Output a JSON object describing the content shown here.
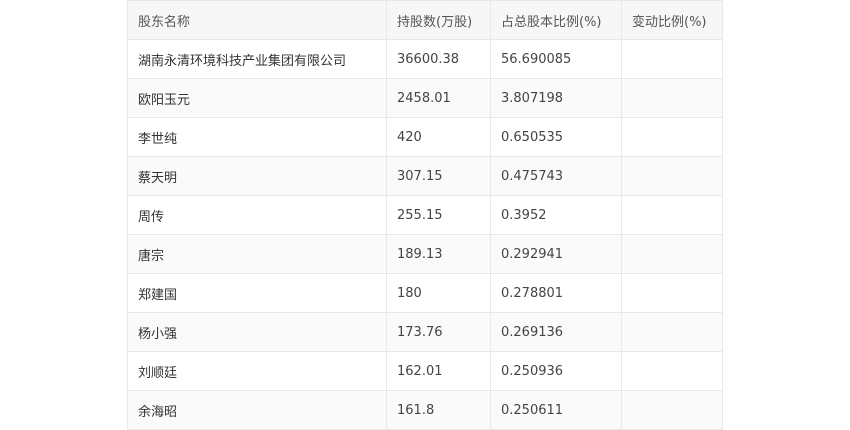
{
  "table": {
    "headers": [
      "股东名称",
      "持股数(万股)",
      "占总股本比例(%)",
      "变动比例(%)"
    ],
    "rows": [
      [
        "湖南永清环境科技产业集团有限公司",
        "36600.38",
        "56.690085",
        ""
      ],
      [
        "欧阳玉元",
        "2458.01",
        "3.807198",
        ""
      ],
      [
        "李世纯",
        "420",
        "0.650535",
        ""
      ],
      [
        "蔡天明",
        "307.15",
        "0.475743",
        ""
      ],
      [
        "周传",
        "255.15",
        "0.3952",
        ""
      ],
      [
        "唐宗",
        "189.13",
        "0.292941",
        ""
      ],
      [
        "郑建国",
        "180",
        "0.278801",
        ""
      ],
      [
        "杨小强",
        "173.76",
        "0.269136",
        ""
      ],
      [
        "刘顺廷",
        "162.01",
        "0.250936",
        ""
      ],
      [
        "余海昭",
        "161.8",
        "0.250611",
        ""
      ]
    ]
  }
}
